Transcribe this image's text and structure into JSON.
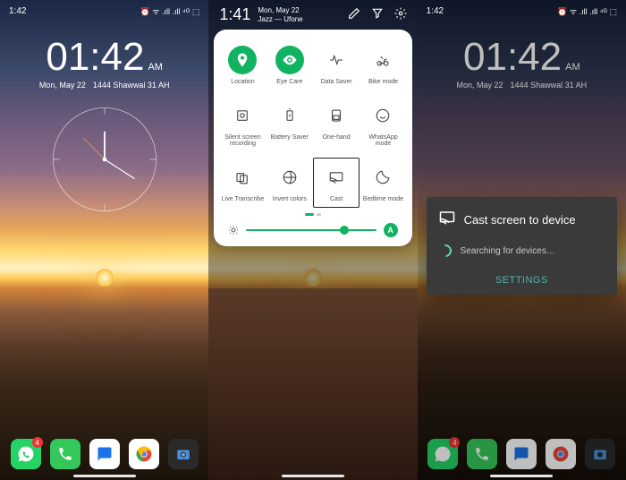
{
  "status": {
    "time": "1:42",
    "icons_label": "⏰ ᯤ .ıll .ıll ⁴ᴳ ⬚"
  },
  "home": {
    "time": "01:42",
    "ampm": "AM",
    "date_left": "Mon, May 22",
    "date_right": "1444 Shawwal 31 AH",
    "whatsapp_badge": "4"
  },
  "qs": {
    "time": "1:41",
    "date": "Mon, May 22",
    "carrier": "Jazz — Ufone",
    "tiles": [
      {
        "label": "Location",
        "active": true
      },
      {
        "label": "Eye Care",
        "active": true
      },
      {
        "label": "Data Saver",
        "active": false
      },
      {
        "label": "Bike mode",
        "active": false
      },
      {
        "label": "Silent screen recording",
        "active": false
      },
      {
        "label": "Battery Saver",
        "active": false
      },
      {
        "label": "One-hand",
        "active": false
      },
      {
        "label": "WhatsApp mode",
        "active": false
      },
      {
        "label": "Live Transcribe",
        "active": false
      },
      {
        "label": "Invert colors",
        "active": false
      },
      {
        "label": "Cast",
        "active": false,
        "boxed": true
      },
      {
        "label": "Bedtime mode",
        "active": false
      }
    ],
    "auto_label": "A"
  },
  "cast": {
    "title": "Cast screen to device",
    "searching": "Searching for devices…",
    "settings": "SETTINGS"
  }
}
